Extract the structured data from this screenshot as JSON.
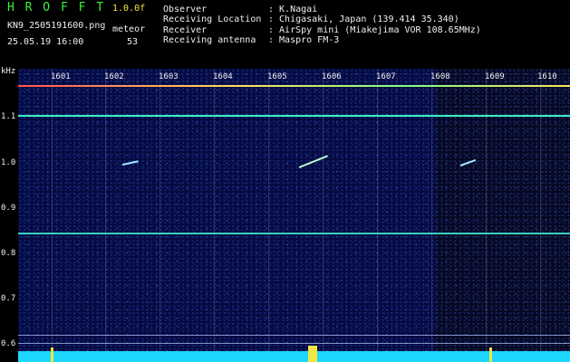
{
  "header": {
    "logo": "H R O F F T",
    "version": "1.0.0f",
    "filename": "KN9_2505191600.png",
    "datetime": "25.05.19 16:00",
    "meteor_label": "meteor",
    "meteor_count": "53",
    "observer_label": "Observer",
    "observer_value": ": K.Nagai",
    "location_label": "Receiving Location",
    "location_value": ": Chigasaki, Japan (139.414 35.340)",
    "receiver_label": "Receiver",
    "receiver_value": ": AirSpy mini (Miakejima VOR 108.65MHz)",
    "antenna_label": "Receiving antenna",
    "antenna_value": ": Maspro FM-3"
  },
  "axes": {
    "y_unit": "kHz",
    "y_ticks": [
      "1.1",
      "1.0",
      "0.9",
      "0.8",
      "0.7",
      "0.6"
    ],
    "x_ticks": [
      "1601",
      "1602",
      "1603",
      "1604",
      "1605",
      "1606",
      "1607",
      "1608",
      "1609",
      "1610"
    ]
  },
  "colors": {
    "background": "#000000",
    "plot_bg": "#050a40",
    "carrier_line": "#3cf0c0",
    "header_green": "#3cf03c",
    "header_yellow": "#f0e840"
  }
}
